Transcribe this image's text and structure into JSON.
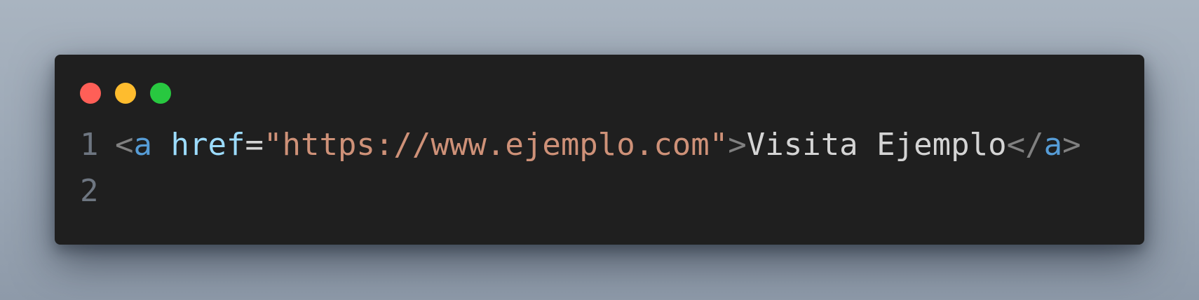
{
  "window": {
    "controls": [
      {
        "name": "close",
        "color": "#ff5f57"
      },
      {
        "name": "minimize",
        "color": "#febc2e"
      },
      {
        "name": "maximize",
        "color": "#28c840"
      }
    ]
  },
  "editor": {
    "lines": [
      {
        "number": "1",
        "tokens": [
          {
            "text": "<",
            "color": "#808080"
          },
          {
            "text": "a",
            "color": "#569cd6"
          },
          {
            "text": " ",
            "color": "#d4d4d4"
          },
          {
            "text": "href",
            "color": "#9cdcfe"
          },
          {
            "text": "=",
            "color": "#d4d4d4"
          },
          {
            "text": "\"https://www.ejemplo.com\"",
            "color": "#ce9178"
          },
          {
            "text": ">",
            "color": "#808080"
          },
          {
            "text": "Visita Ejemplo",
            "color": "#d4d4d4"
          },
          {
            "text": "</",
            "color": "#808080"
          },
          {
            "text": "a",
            "color": "#569cd6"
          },
          {
            "text": ">",
            "color": "#808080"
          }
        ]
      },
      {
        "number": "2",
        "tokens": []
      }
    ]
  }
}
